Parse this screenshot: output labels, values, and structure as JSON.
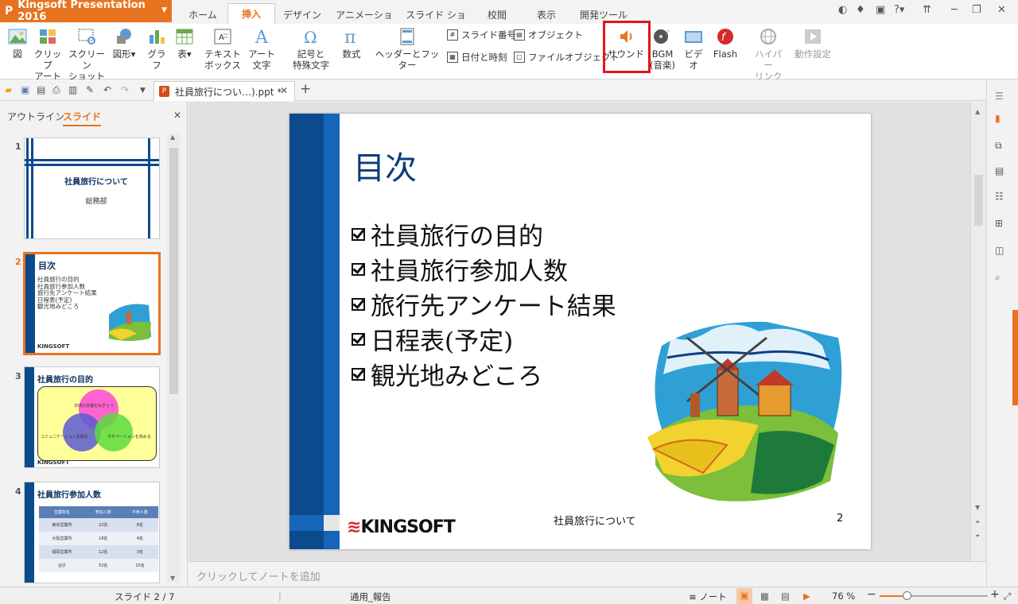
{
  "app": {
    "title": "Kingsoft Presentation 2016",
    "logo": "P"
  },
  "menu_tabs": [
    "ホーム",
    "挿入",
    "デザイン",
    "アニメーション",
    "スライド ショー",
    "校閲",
    "表示",
    "開発ツール"
  ],
  "active_tab": "挿入",
  "ribbon": {
    "picture": "図",
    "clipart": "クリップ\nアート",
    "screenshot": "スクリーン\nショット",
    "shapes": "図形",
    "graph": "グラフ",
    "table": "表",
    "textbox": "テキスト\nボックス",
    "wordart": "アート\n文字",
    "symbol": "記号と\n特殊文字",
    "equation": "数式",
    "header_footer": "ヘッダーとフッター",
    "slide_number": "スライド番号",
    "date_time": "日付と時刻",
    "object": "オブジェクト",
    "file_object": "ファイルオブジェクト",
    "sound": "サウンド",
    "bgm": "BGM\n(音楽)",
    "video": "ビデオ",
    "flash": "Flash",
    "hyperlink": "ハイパー\nリンク",
    "action": "動作設定"
  },
  "document_tab": {
    "title": "社員旅行につい…).ppt *"
  },
  "left_pane": {
    "tab_outline": "アウトライン",
    "tab_slides": "スライド"
  },
  "thumbnails": [
    {
      "num": "1",
      "title": "社員旅行について",
      "sub": "総務部"
    },
    {
      "num": "2",
      "title": "目次",
      "items": [
        "社員旅行の目的",
        "社員旅行参加人数",
        "旅行先アンケート結果",
        "日程表(予定)",
        "観光地みどころ"
      ],
      "brand": "KINGSOFT"
    },
    {
      "num": "3",
      "title": "社員旅行の目的",
      "circle1": "日頃の労働をねぎらう",
      "circle2": "コミュニケーションを図る",
      "circle3": "モチベーションを高める",
      "brand": "KINGSOFT"
    },
    {
      "num": "4",
      "title": "社員旅行参加人数",
      "headers": [
        "営業所名",
        "参加人数",
        "不参人数"
      ],
      "rows": [
        [
          "東京営業所",
          "22名",
          "8名"
        ],
        [
          "大阪営業所",
          "18名",
          "4名"
        ],
        [
          "福岡営業所",
          "12名",
          "3名"
        ],
        [
          "合計",
          "52名",
          "15名"
        ]
      ]
    }
  ],
  "slide": {
    "title": "目次",
    "bullets": [
      "社員旅行の目的",
      "社員旅行参加人数",
      "旅行先アンケート結果",
      "日程表(予定)",
      "観光地みどころ"
    ],
    "footer": "社員旅行について",
    "page": "2",
    "brand": "KINGSOFT"
  },
  "notes_placeholder": "クリックしてノートを追加",
  "status": {
    "slide_info": "スライド 2 / 7",
    "template": "通用_報告",
    "notes_toggle": "ノート",
    "zoom": "76 %",
    "zoom_level_percent": 76
  },
  "colors": {
    "accent": "#e8731f",
    "slide_navy": "#0b4a8c",
    "slide_blue": "#1565b8",
    "highlight_red": "#e0161e"
  }
}
